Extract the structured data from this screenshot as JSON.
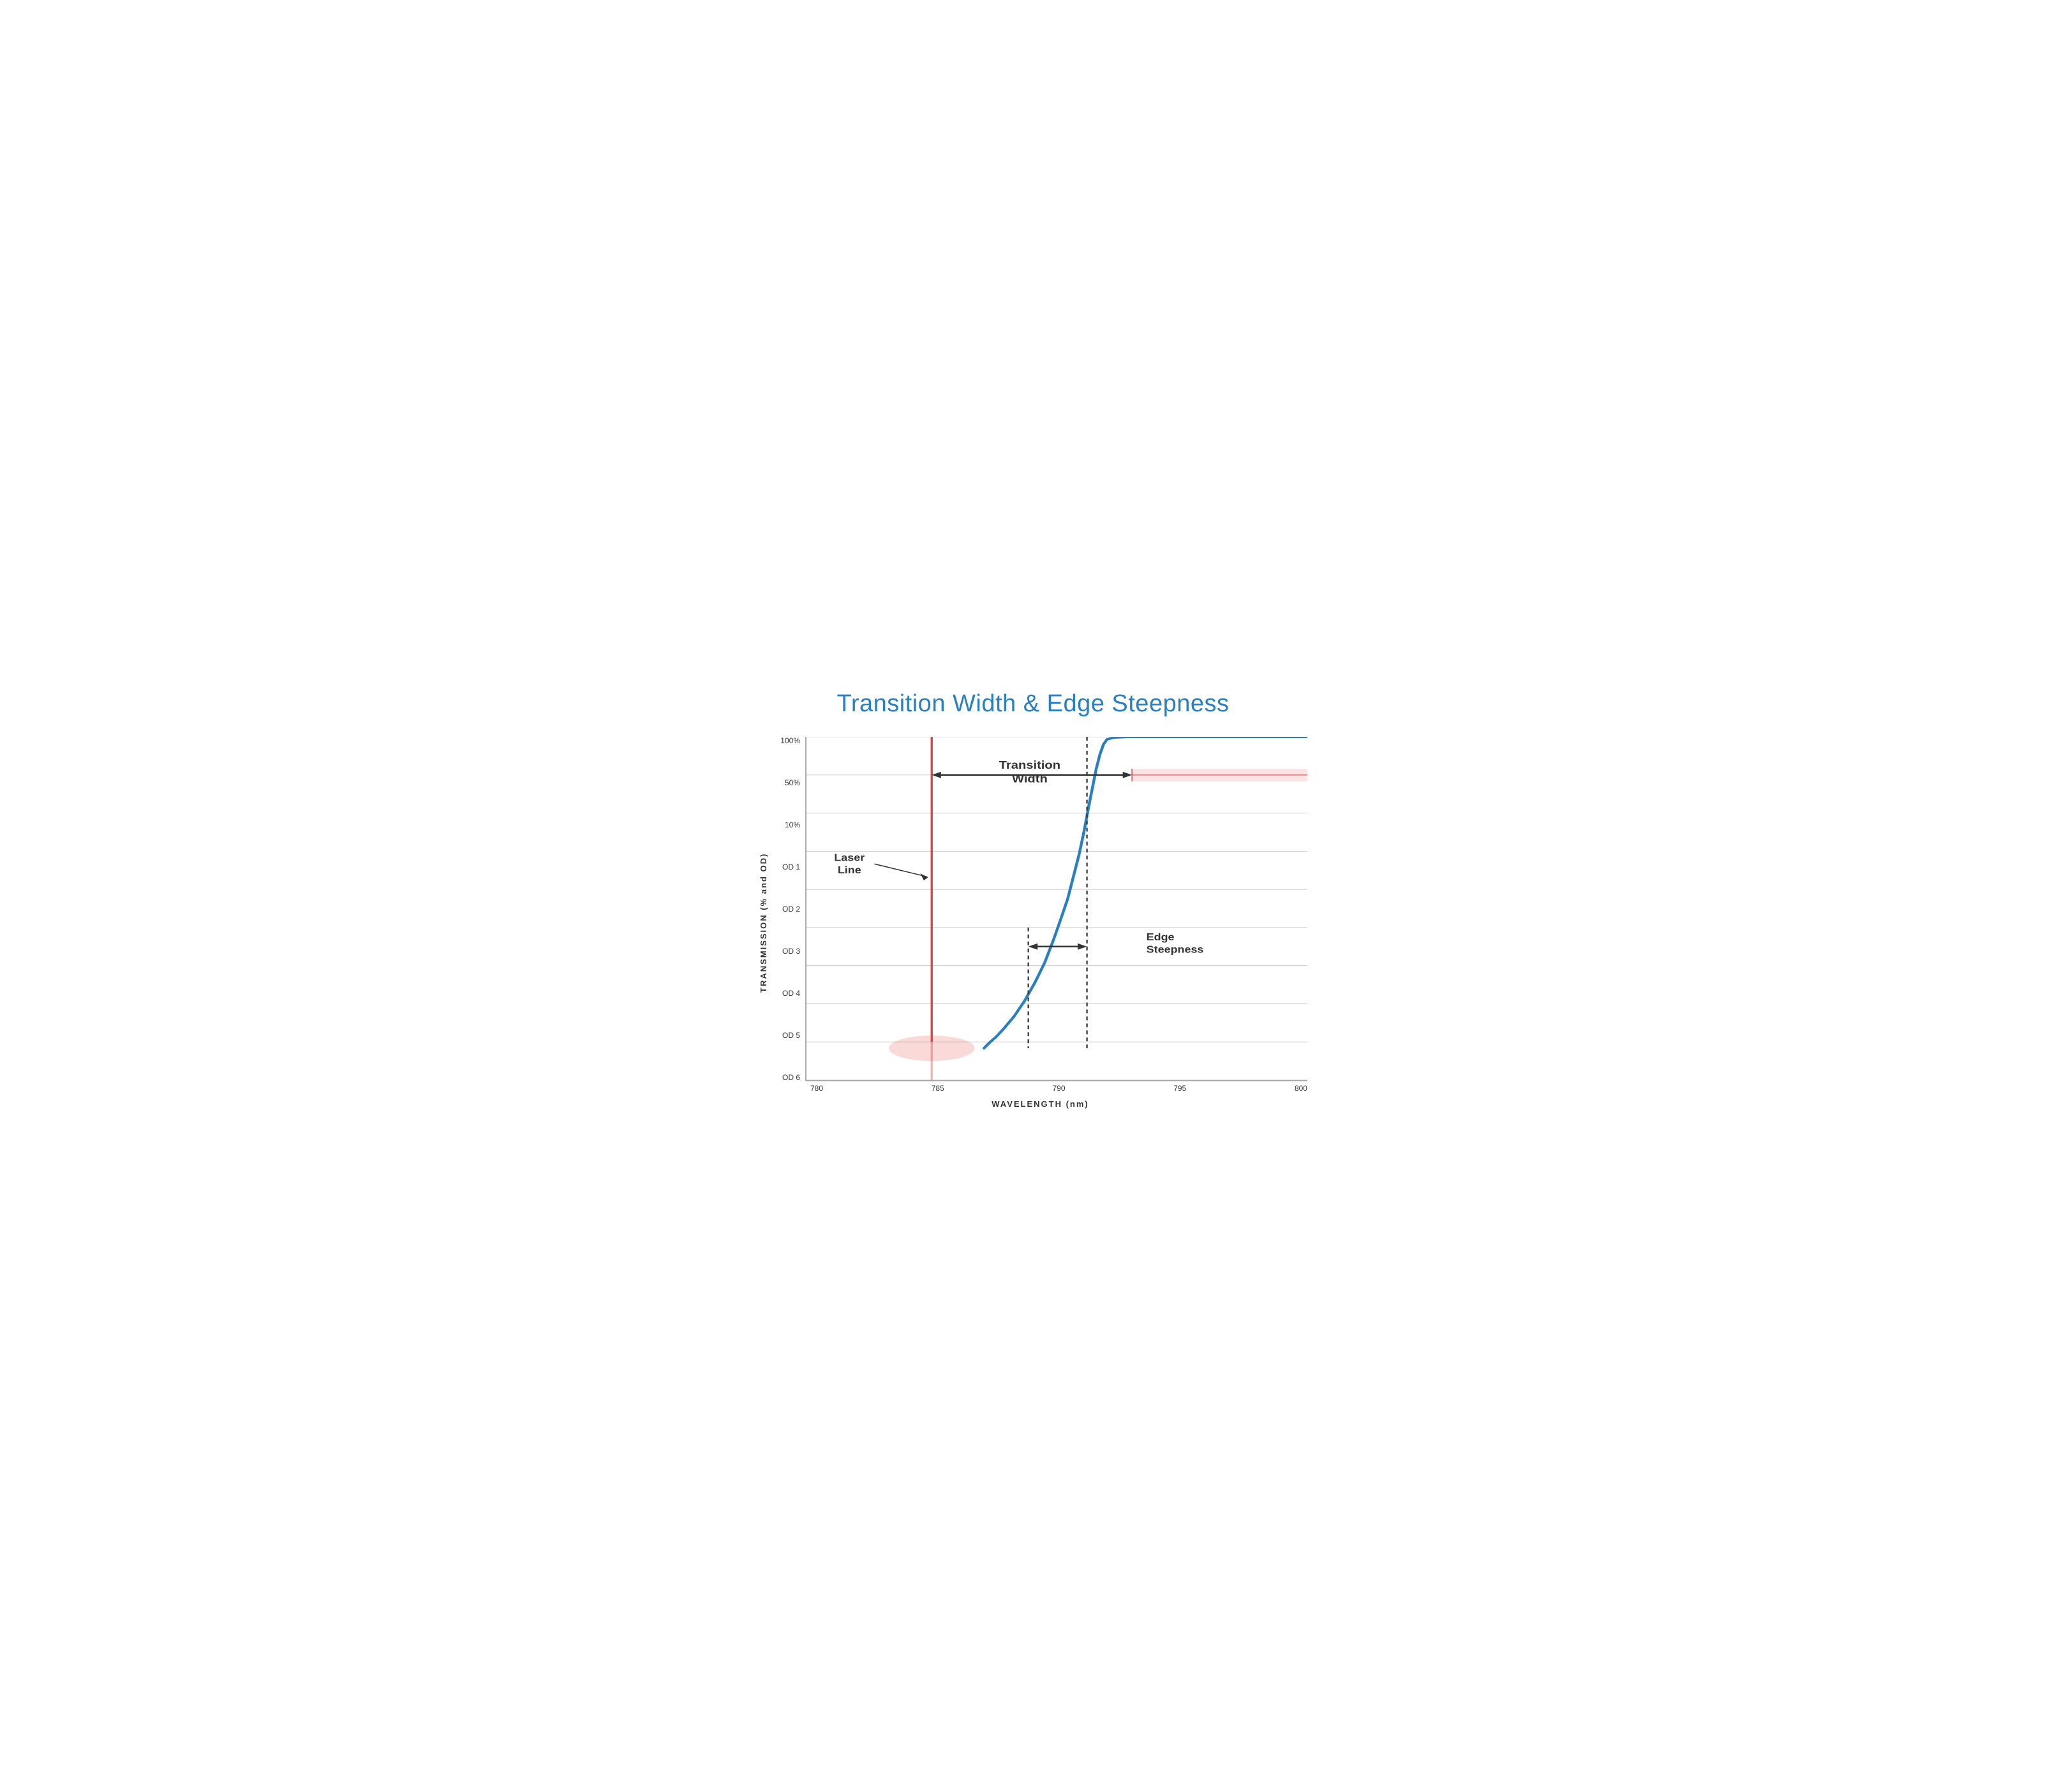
{
  "title": "Transition Width & Edge Steepness",
  "y_axis_label": "TRANSMISSION (% and OD)",
  "x_axis_label": "WAVELENGTH (nm)",
  "y_ticks": [
    "100%",
    "50%",
    "10%",
    "OD 1",
    "OD 2",
    "OD 3",
    "OD 4",
    "OD 5",
    "OD 6"
  ],
  "x_ticks": [
    "780",
    "785",
    "790",
    "795",
    "800"
  ],
  "annotations": {
    "transition_width": "Transition\nWidth",
    "laser_line": "Laser\nLine",
    "edge_steepness": "Edge\nSteepness"
  },
  "colors": {
    "blue": "#2a7fc1",
    "red": "#e84040",
    "red_faded": "rgba(232,64,64,0.3)",
    "arrow": "#333333",
    "grid": "#cccccc"
  }
}
